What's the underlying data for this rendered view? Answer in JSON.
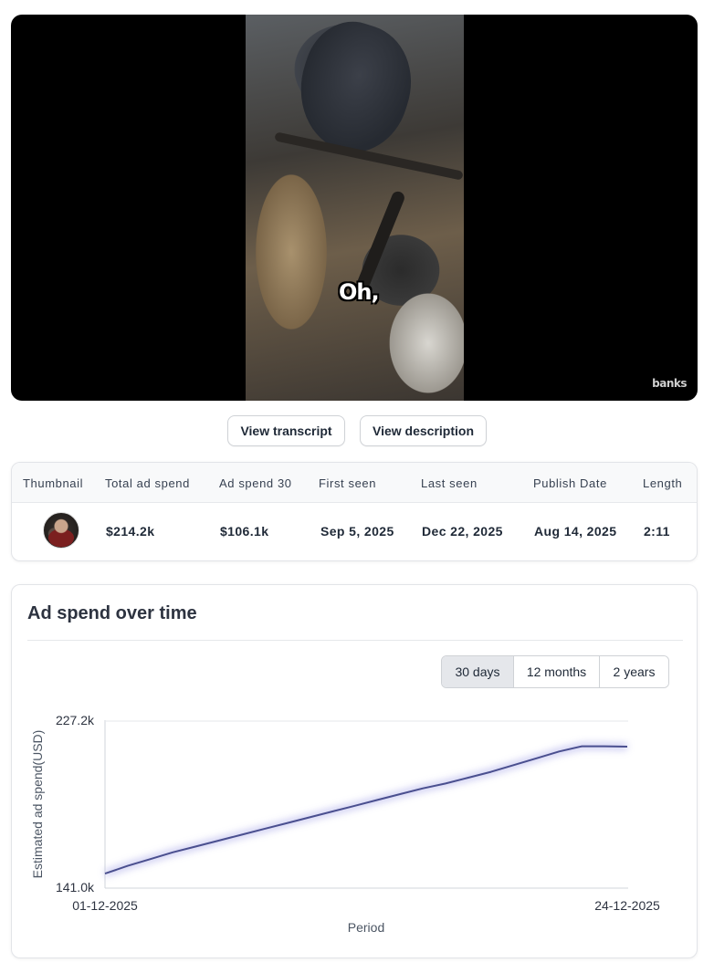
{
  "video": {
    "caption": "Oh,",
    "watermark": "banks"
  },
  "actions": {
    "transcript_label": "View transcript",
    "description_label": "View description"
  },
  "table": {
    "headers": [
      "Thumbnail",
      "Total ad spend",
      "Ad spend 30",
      "First seen",
      "Last seen",
      "Publish Date",
      "Length"
    ],
    "row": {
      "total_ad_spend": "$214.2k",
      "ad_spend_30": "$106.1k",
      "first_seen": "Sep 5, 2025",
      "last_seen": "Dec 22, 2025",
      "publish_date": "Aug 14, 2025",
      "length": "2:11"
    }
  },
  "chart_section": {
    "title": "Ad spend over time",
    "ranges": [
      "30 days",
      "12 months",
      "2 years"
    ],
    "active_range": "30 days"
  },
  "chart_data": {
    "type": "line",
    "title": "Ad spend over time",
    "xlabel": "Period",
    "ylabel": "Estimated ad spend(USD)",
    "x_tick_labels": [
      "01-12-2025",
      "24-12-2025"
    ],
    "y_tick_labels": [
      "227.2k",
      "141.0k"
    ],
    "ylim": [
      141.0,
      227.2
    ],
    "x": [
      "01-12-2025",
      "02-12-2025",
      "03-12-2025",
      "04-12-2025",
      "05-12-2025",
      "06-12-2025",
      "07-12-2025",
      "08-12-2025",
      "09-12-2025",
      "10-12-2025",
      "11-12-2025",
      "12-12-2025",
      "13-12-2025",
      "14-12-2025",
      "15-12-2025",
      "16-12-2025",
      "17-12-2025",
      "18-12-2025",
      "19-12-2025",
      "20-12-2025",
      "21-12-2025",
      "22-12-2025",
      "23-12-2025",
      "24-12-2025"
    ],
    "series": [
      {
        "values": [
          148.5,
          152.5,
          156.0,
          159.5,
          162.5,
          165.5,
          168.5,
          171.5,
          174.5,
          177.5,
          180.5,
          183.5,
          186.5,
          189.5,
          192.5,
          195.0,
          198.0,
          201.0,
          204.5,
          208.0,
          211.5,
          214.2,
          214.2,
          214.0
        ],
        "color": "#4a4f8f"
      }
    ],
    "grid": false
  }
}
